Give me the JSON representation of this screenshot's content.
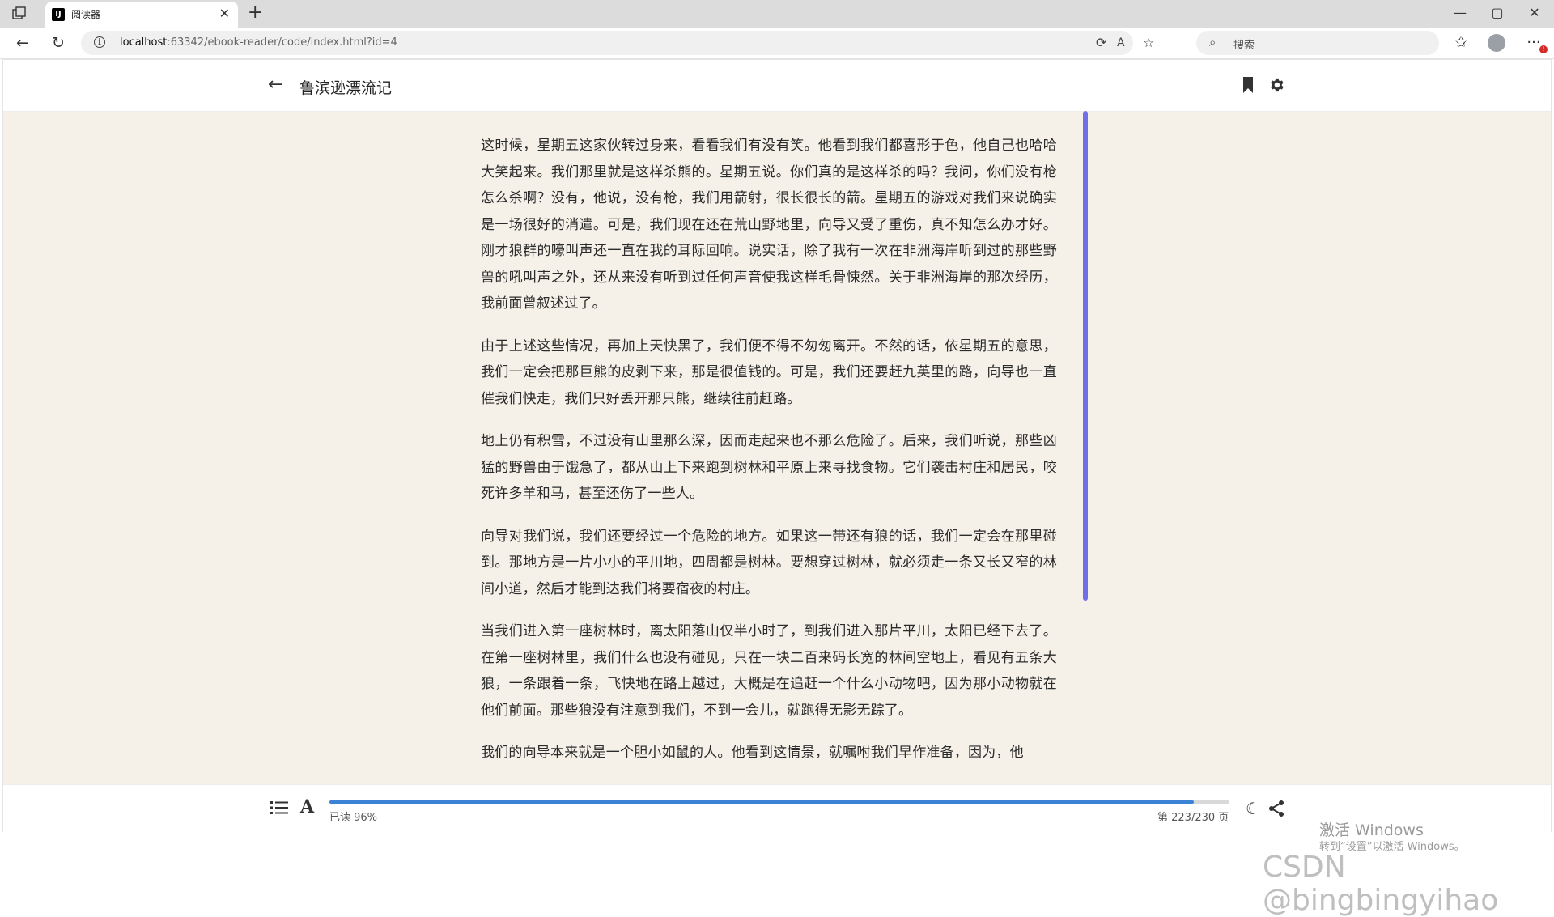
{
  "browser": {
    "tab_title": "阅读器",
    "tab_favicon": "IJ",
    "new_tab_glyph": "+",
    "close_glyph": "✕",
    "url_host": "localhost",
    "url_rest": ":63342/ebook-reader/code/index.html?id=4",
    "search_placeholder": "搜索",
    "window_controls": [
      "—",
      "▢",
      "✕"
    ]
  },
  "header": {
    "title": "鲁滨逊漂流记"
  },
  "content": {
    "paragraphs": [
      "这时候，星期五这家伙转过身来，看看我们有没有笑。他看到我们都喜形于色，他自己也哈哈大笑起来。我们那里就是这样杀熊的。星期五说。你们真的是这样杀的吗？我问，你们没有枪怎么杀啊？没有，他说，没有枪，我们用箭射，很长很长的箭。星期五的游戏对我们来说确实是一场很好的消遣。可是，我们现在还在荒山野地里，向导又受了重伤，真不知怎么办才好。刚才狼群的嚎叫声还一直在我的耳际回响。说实话，除了我有一次在非洲海岸听到过的那些野兽的吼叫声之外，还从来没有听到过任何声音使我这样毛骨悚然。关于非洲海岸的那次经历，我前面曾叙述过了。",
      "由于上述这些情况，再加上天快黑了，我们便不得不匆匆离开。不然的话，依星期五的意思，我们一定会把那巨熊的皮剥下来，那是很值钱的。可是，我们还要赶九英里的路，向导也一直催我们快走，我们只好丢开那只熊，继续往前赶路。",
      "地上仍有积雪，不过没有山里那么深，因而走起来也不那么危险了。后来，我们听说，那些凶猛的野兽由于饿急了，都从山上下来跑到树林和平原上来寻找食物。它们袭击村庄和居民，咬死许多羊和马，甚至还伤了一些人。",
      "向导对我们说，我们还要经过一个危险的地方。如果这一带还有狼的话，我们一定会在那里碰到。那地方是一片小小的平川地，四周都是树林。要想穿过树林，就必须走一条又长又窄的林间小道，然后才能到达我们将要宿夜的村庄。",
      "当我们进入第一座树林时，离太阳落山仅半小时了，到我们进入那片平川，太阳已经下去了。在第一座树林里，我们什么也没有碰见，只在一块二百来码长宽的林间空地上，看见有五条大狼，一条跟着一条，飞快地在路上越过，大概是在追赶一个什么小动物吧，因为那小动物就在他们前面。那些狼没有注意到我们，不到一会儿，就跑得无影无踪了。",
      "我们的向导本来就是一个胆小如鼠的人。他看到这情景，就嘱咐我们早作准备，因为，他"
    ]
  },
  "footer": {
    "progress": 0.96,
    "read_label": "已读 96%",
    "page_label": "第 223/230 页"
  },
  "watermark": {
    "line1": "激活 Windows",
    "line2": "转到“设置”以激活 Windows。",
    "csdn": "CSDN @bingbingyihao"
  },
  "colors": {
    "reader_bg": "#f5f1e8",
    "accent": "#3c82d6",
    "scrollbar": "#6f6fe8"
  }
}
